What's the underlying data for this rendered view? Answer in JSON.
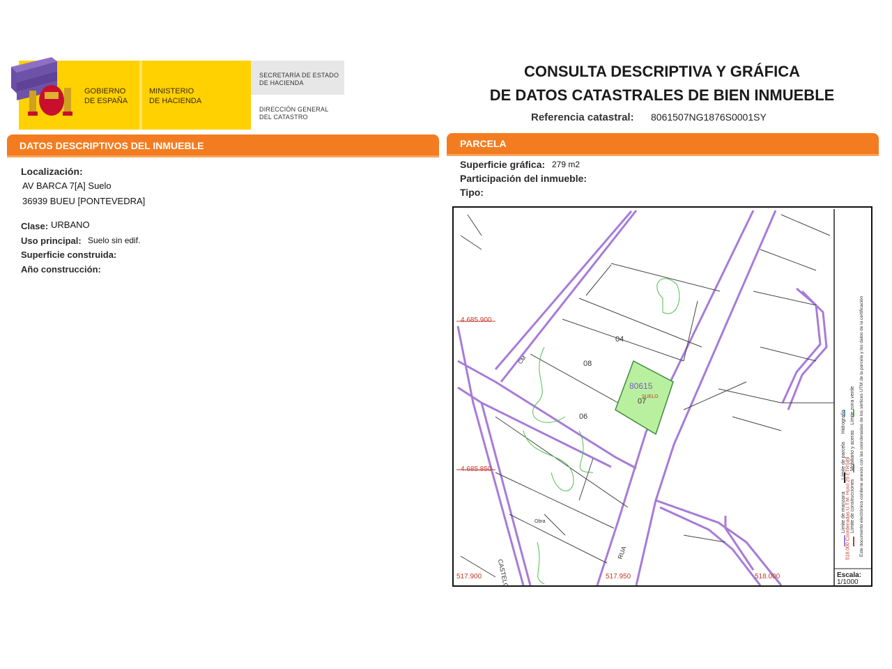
{
  "header": {
    "gov_line1": "GOBIERNO",
    "gov_line2": "DE ESPAÑA",
    "min_line1": "MINISTERIO",
    "min_line2": "DE HACIENDA",
    "sec_line1": "SECRETARÍA DE ESTADO",
    "sec_line2": "DE HACIENDA",
    "dir_line1": "DIRECCIÓN GENERAL",
    "dir_line2": "DEL CATASTRO",
    "title_line1": "CONSULTA DESCRIPTIVA Y GRÁFICA",
    "title_line2": "DE DATOS CATASTRALES DE BIEN INMUEBLE",
    "ref_label": "Referencia catastral:",
    "ref_value": "8061507NG1876S0001SY"
  },
  "left": {
    "section_title": "DATOS DESCRIPTIVOS DEL INMUEBLE",
    "loc_label": "Localización:",
    "loc_line1": "AV BARCA 7[A] Suelo",
    "loc_line2": "36939 BUEU [PONTEVEDRA]",
    "clase_label": "Clase:",
    "clase_value": "URBANO",
    "uso_label": "Uso principal:",
    "uso_value": "Suelo sin edif.",
    "sup_label": "Superficie construida:",
    "anio_label": "Año construcción:"
  },
  "right": {
    "section_title": "PARCELA",
    "supg_label": "Superficie gráfica:",
    "supg_value": "279 m2",
    "part_label": "Participación del inmueble:",
    "tipo_label": "Tipo:"
  },
  "map": {
    "coords": {
      "y1": "4.685.900",
      "y2": "4.685.850",
      "x1": "517.900",
      "x2": "517.950",
      "x3": "518.000"
    },
    "parcel_number": "80615",
    "parcel_sub": "SUELO",
    "labels": {
      "n04": "04",
      "n08": "08",
      "n07": "07",
      "n06": "06",
      "obra": "Obra",
      "rua": "RUA",
      "castelo": "CASTELO",
      "cm": "CM"
    },
    "legend": {
      "l1": "Límite de manzana",
      "l2": "Límite de parcela",
      "l3": "Límite de construcciones",
      "l4": "Mobiliario y aceras",
      "l5": "Límite zona verde",
      "l6": "Hidrografía",
      "utm": "518.000 Coordenadas U.T.M. Huso 29 ETRS89",
      "note": "Este documento electrónico contiene anexos con las coordenadas de los vértices UTM de la parcela y los datos de la certificación"
    },
    "scale_label": "Escala:",
    "scale_value": "1/1000"
  },
  "colors": {
    "orange": "#f47c20",
    "yellow": "#ffd100",
    "purple": "#b48ae0",
    "parcel_green": "#b9f0a0"
  }
}
